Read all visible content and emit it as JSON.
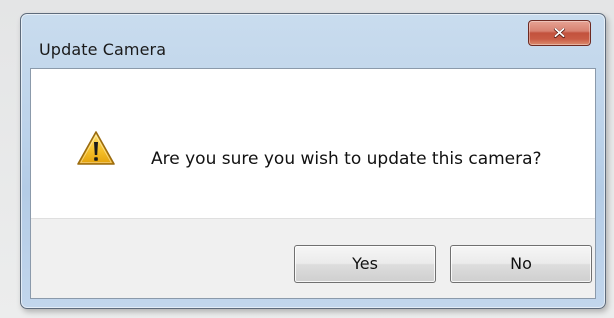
{
  "dialog": {
    "title": "Update Camera",
    "message": "Are you sure you wish to update this camera?",
    "icon": "warning-icon",
    "close_icon": "close-icon"
  },
  "buttons": {
    "yes_label": "Yes",
    "no_label": "No"
  },
  "colors": {
    "titlebar": "#bdd3ea",
    "close_button": "#c95b45",
    "warning": "#f1c232"
  }
}
